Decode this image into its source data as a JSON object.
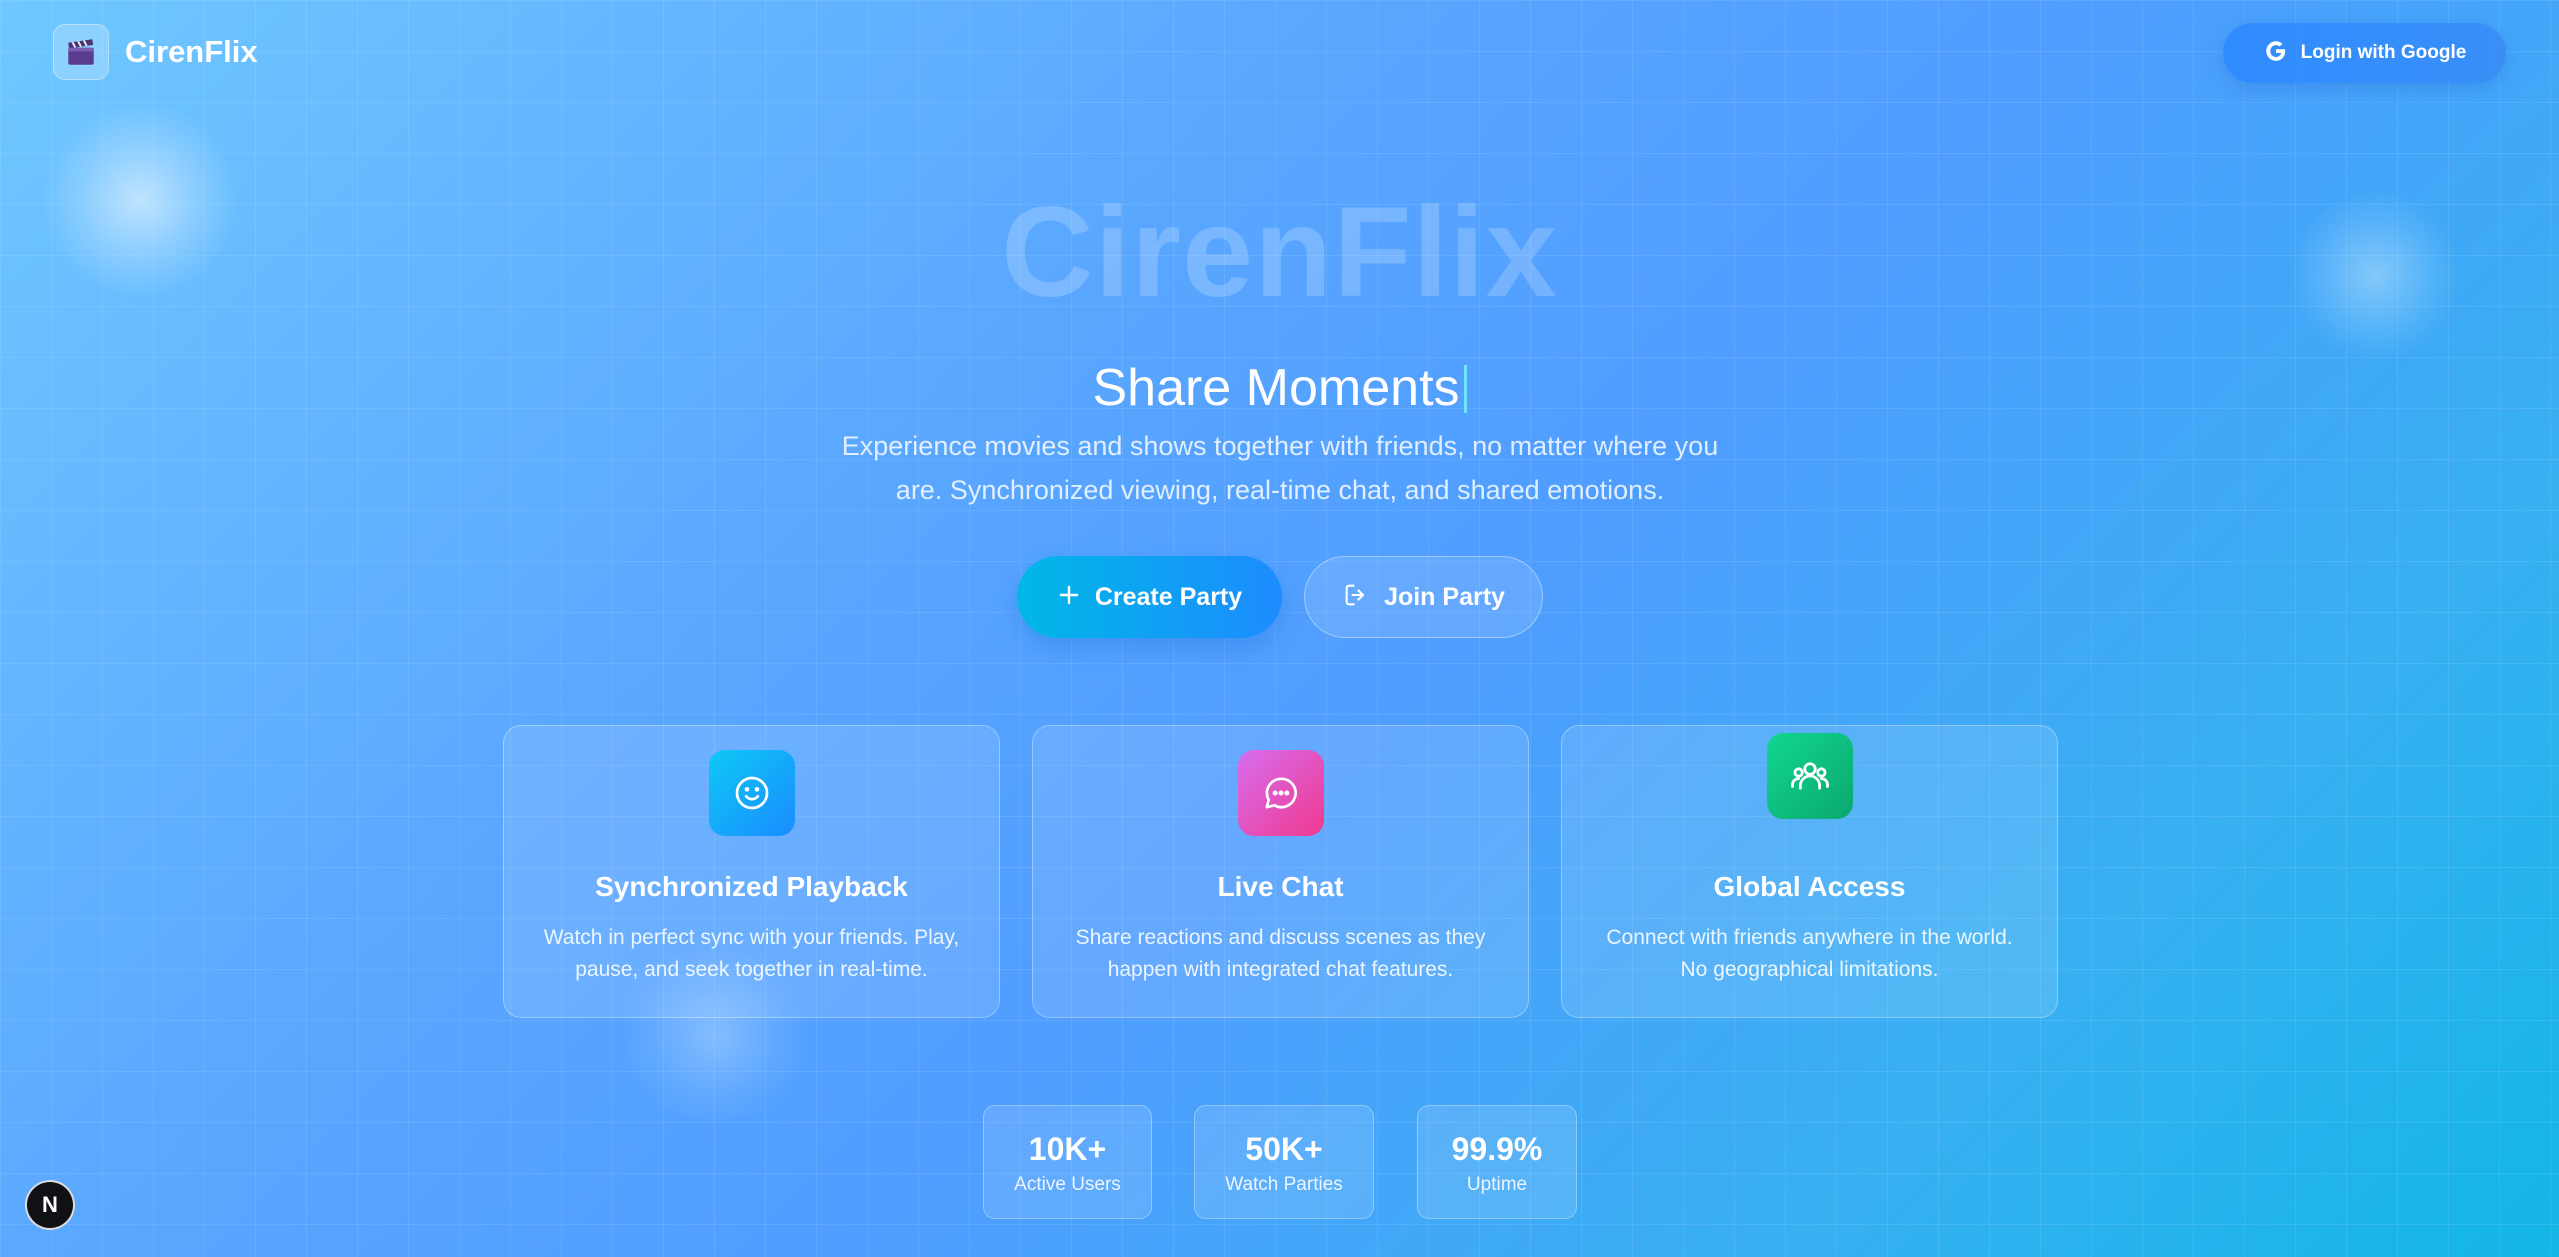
{
  "brand": {
    "name": "CirenFlix",
    "logo_icon": "clapperboard-icon"
  },
  "header": {
    "login_label": "Login with Google",
    "login_icon": "google-icon"
  },
  "hero": {
    "title": "CirenFlix",
    "tagline": "Share Moments",
    "description": "Experience movies and shows together with friends, no matter where you are. Synchronized viewing, real-time chat, and shared emotions."
  },
  "actions": {
    "create_label": "Create Party",
    "create_icon": "plus-icon",
    "join_label": "Join Party",
    "join_icon": "log-in-icon"
  },
  "features": [
    {
      "title": "Synchronized Playback",
      "description": "Watch in perfect sync with your friends. Play, pause, and seek together in real-time.",
      "icon": "smile-icon",
      "color": "#0ea5f0"
    },
    {
      "title": "Live Chat",
      "description": "Share reactions and discuss scenes as they happen with integrated chat features.",
      "icon": "chat-bubble-icon",
      "color": "#ec4fc4"
    },
    {
      "title": "Global Access",
      "description": "Connect with friends anywhere in the world. No geographical limitations.",
      "icon": "users-icon",
      "color": "#10c98a"
    }
  ],
  "stats": [
    {
      "value": "10K+",
      "label": "Active Users"
    },
    {
      "value": "50K+",
      "label": "Watch Parties"
    },
    {
      "value": "99.9%",
      "label": "Uptime"
    }
  ],
  "dev_badge": {
    "letter": "N"
  },
  "colors": {
    "accent": "#2f8cff",
    "cyan": "#00b8e6",
    "background_start": "#6fc8ff",
    "background_end": "#12b6e6"
  }
}
